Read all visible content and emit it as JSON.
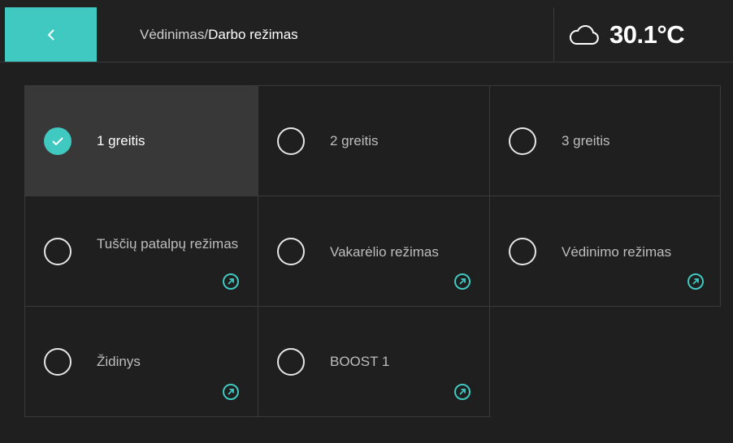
{
  "header": {
    "breadcrumb_parent": "Vėdinimas/",
    "breadcrumb_current": "Darbo režimas",
    "back_icon": "chevron-left-icon",
    "weather_icon": "cloud-icon",
    "temperature": "30.1°C",
    "accent_color": "#3fc9c1"
  },
  "modes": [
    {
      "label": "1 greitis",
      "selected": true,
      "has_link": false
    },
    {
      "label": "2 greitis",
      "selected": false,
      "has_link": false
    },
    {
      "label": "3 greitis",
      "selected": false,
      "has_link": false
    },
    {
      "label": "Tuščių patalpų režimas",
      "selected": false,
      "has_link": true
    },
    {
      "label": "Vakarėlio režimas",
      "selected": false,
      "has_link": true
    },
    {
      "label": "Vėdinimo režimas",
      "selected": false,
      "has_link": true
    },
    {
      "label": "Židinys",
      "selected": false,
      "has_link": true
    },
    {
      "label": "BOOST 1",
      "selected": false,
      "has_link": true
    }
  ]
}
